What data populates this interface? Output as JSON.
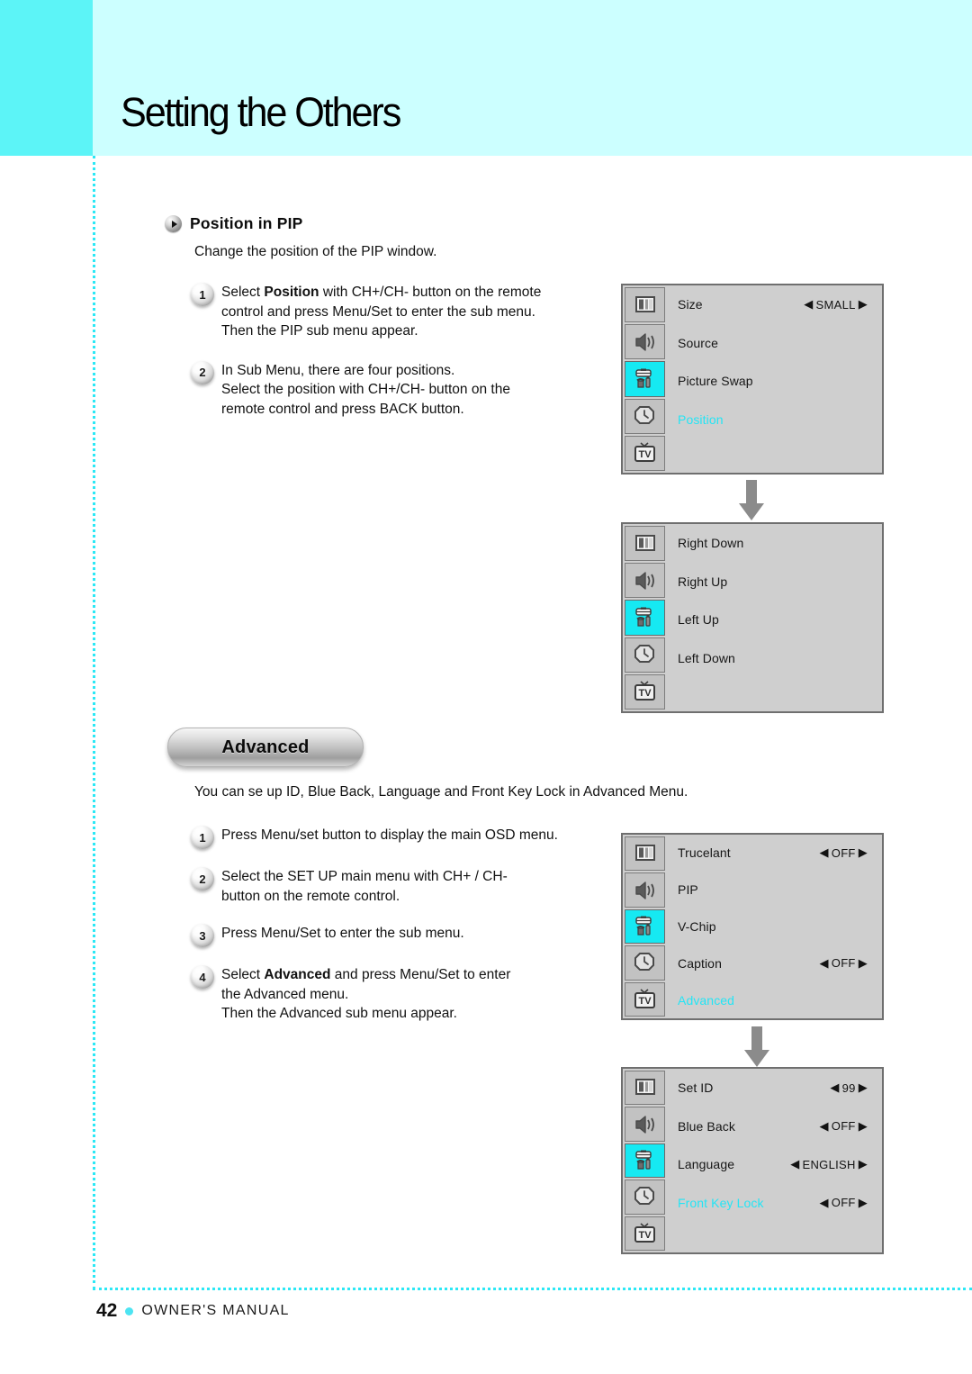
{
  "page": {
    "title": "Setting the Others",
    "footer_page_number": "42",
    "footer_label": "OWNER'S MANUAL",
    "accent_cyan": "#5cf4f7",
    "header_band": "#ccffff",
    "osd_highlight": "#16e9f2",
    "osd_selected_text": "#24e5f5"
  },
  "section_pip": {
    "heading": "Position in PIP",
    "lead": "Change the position of the PIP window.",
    "steps": [
      {
        "number": "1",
        "lines": [
          {
            "pre": "Select ",
            "bold": "Position",
            "post": " with CH+/CH- button on the remote"
          },
          {
            "pre": "control and press Menu/Set to enter the sub menu.",
            "bold": "",
            "post": ""
          },
          {
            "pre": "Then the PIP sub menu appear.",
            "bold": "",
            "post": ""
          }
        ]
      },
      {
        "number": "2",
        "lines": [
          {
            "pre": "In Sub Menu, there are four positions.",
            "bold": "",
            "post": ""
          },
          {
            "pre": "Select the position with CH+/CH- button on the",
            "bold": "",
            "post": ""
          },
          {
            "pre": "remote control  and press BACK button.",
            "bold": "",
            "post": ""
          }
        ]
      }
    ]
  },
  "section_advanced": {
    "pill_label": "Advanced",
    "description": "You can se up ID, Blue Back, Language and Front Key Lock in Advanced Menu.",
    "steps": [
      {
        "number": "1",
        "lines": [
          {
            "pre": "Press Menu/set button to display the main OSD menu.",
            "bold": "",
            "post": ""
          }
        ]
      },
      {
        "number": "2",
        "lines": [
          {
            "pre": "Select the SET UP main menu with CH+ / CH-",
            "bold": "",
            "post": ""
          },
          {
            "pre": "button on the remote control.",
            "bold": "",
            "post": ""
          }
        ]
      },
      {
        "number": "3",
        "lines": [
          {
            "pre": "Press Menu/Set to enter the sub menu.",
            "bold": "",
            "post": ""
          }
        ]
      },
      {
        "number": "4",
        "lines": [
          {
            "pre": "Select ",
            "bold": "Advanced",
            "post": " and press Menu/Set to enter"
          },
          {
            "pre": "the Advanced menu.",
            "bold": "",
            "post": ""
          },
          {
            "pre": "Then the Advanced sub menu appear.",
            "bold": "",
            "post": ""
          }
        ]
      }
    ]
  },
  "osd_rail_icons": [
    {
      "name": "picture-icon",
      "label": "Picture"
    },
    {
      "name": "speaker-icon",
      "label": "Sound"
    },
    {
      "name": "toolbox-icon",
      "label": "Set Up"
    },
    {
      "name": "clock-icon",
      "label": "Time"
    },
    {
      "name": "tv-icon",
      "label": "TV"
    }
  ],
  "osd_panels": [
    {
      "id": "pip-menu",
      "active_rail_index": 2,
      "rows": [
        {
          "label": "Size",
          "value": "SMALL",
          "has_arrows": true,
          "selected": false
        },
        {
          "label": "Source",
          "value": "",
          "has_arrows": false,
          "selected": false
        },
        {
          "label": "Picture Swap",
          "value": "",
          "has_arrows": false,
          "selected": false
        },
        {
          "label": "Position",
          "value": "",
          "has_arrows": false,
          "selected": true
        }
      ]
    },
    {
      "id": "pip-position-submenu",
      "active_rail_index": 2,
      "rows": [
        {
          "label": "Right Down",
          "value": "",
          "has_arrows": false,
          "selected": false
        },
        {
          "label": "Right Up",
          "value": "",
          "has_arrows": false,
          "selected": false
        },
        {
          "label": "Left Up",
          "value": "",
          "has_arrows": false,
          "selected": false
        },
        {
          "label": "Left Down",
          "value": "",
          "has_arrows": false,
          "selected": false
        }
      ]
    },
    {
      "id": "setup-menu",
      "active_rail_index": 2,
      "rows": [
        {
          "label": "Trucelant",
          "value": "OFF",
          "has_arrows": true,
          "selected": false
        },
        {
          "label": "PIP",
          "value": "",
          "has_arrows": false,
          "selected": false
        },
        {
          "label": "V-Chip",
          "value": "",
          "has_arrows": false,
          "selected": false
        },
        {
          "label": "Caption",
          "value": "OFF",
          "has_arrows": true,
          "selected": false
        },
        {
          "label": "Advanced",
          "value": "",
          "has_arrows": false,
          "selected": true
        }
      ]
    },
    {
      "id": "advanced-submenu",
      "active_rail_index": 2,
      "rows": [
        {
          "label": "Set ID",
          "value": "99",
          "has_arrows": true,
          "selected": false
        },
        {
          "label": "Blue Back",
          "value": "OFF",
          "has_arrows": true,
          "selected": false
        },
        {
          "label": "Language",
          "value": "ENGLISH",
          "has_arrows": true,
          "selected": false
        },
        {
          "label": "Front Key Lock",
          "value": "OFF",
          "has_arrows": true,
          "selected": true
        }
      ]
    }
  ],
  "arrows": {
    "glyph": "down-arrow-icon",
    "count": 2
  }
}
